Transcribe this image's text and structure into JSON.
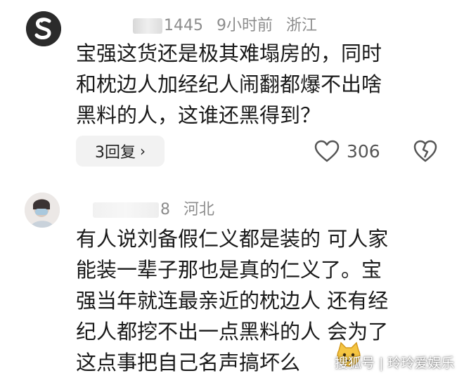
{
  "comments": [
    {
      "user_suffix": "1445",
      "time": "9小时前",
      "location": "浙江",
      "lines": [
        "宝强这货还是极其难塌房的，同时",
        "和枕边人加经纪人闹翻都爆不出啥",
        "黑料的人，这谁还黑得到？"
      ],
      "reply_label": "3回复",
      "like_count": "306",
      "avatar_icon": "brand-s-logo-icon"
    },
    {
      "user_suffix": "8",
      "location": "河北",
      "lines": [
        "有人说刘备假仁义都是装的  可人家",
        "能装一辈子那也是真的仁义了。宝",
        "强当年就连最亲近的枕边人  还有经",
        "纪人都挖不出一点黑料的人  会为了",
        "这点事把自己名声搞坏么"
      ],
      "avatar_icon": "user-photo-avatar"
    }
  ],
  "watermark": "搜狐号 | 玲玲爱娱乐",
  "colors": {
    "meta_gray": "#8c8c8c",
    "reply_bg": "#f2f2f2",
    "text": "#1a1a1a"
  }
}
